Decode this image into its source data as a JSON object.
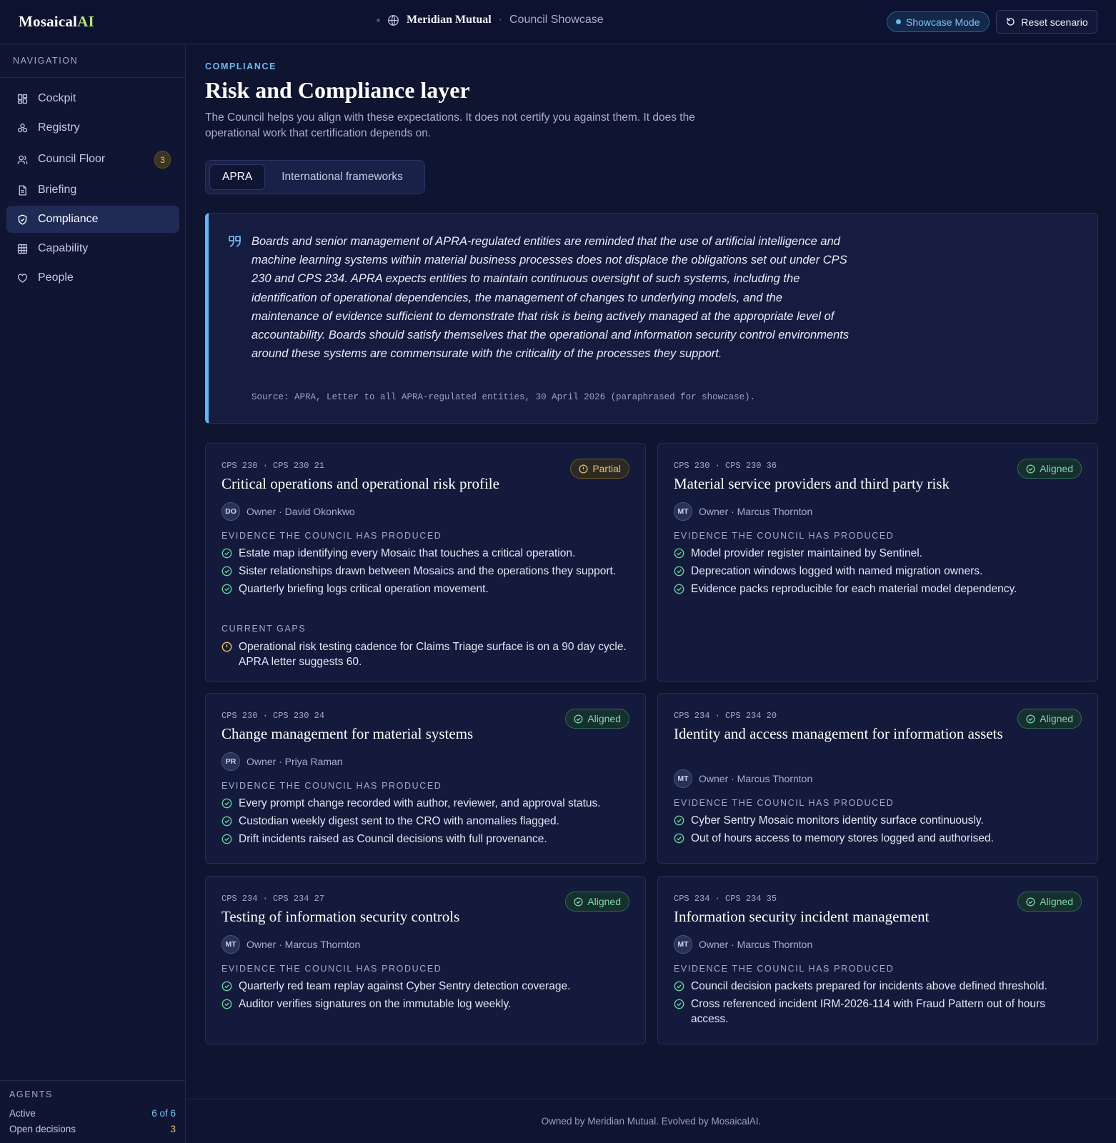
{
  "brand": {
    "name_main": "Mosaical",
    "name_accent": "AI"
  },
  "header": {
    "client": "Meridian Mutual",
    "separator": "·",
    "crumb": "Council Showcase",
    "showcase_label": "Showcase Mode",
    "reset_label": "Reset scenario"
  },
  "sidebar": {
    "heading": "NAVIGATION",
    "items": [
      {
        "label": "Cockpit",
        "icon": "grid-icon"
      },
      {
        "label": "Registry",
        "icon": "registry-icon"
      },
      {
        "label": "Council Floor",
        "icon": "users-icon",
        "badge": "3"
      },
      {
        "label": "Briefing",
        "icon": "document-icon"
      },
      {
        "label": "Compliance",
        "icon": "shield-icon",
        "active": true
      },
      {
        "label": "Capability",
        "icon": "table-icon"
      },
      {
        "label": "People",
        "icon": "heart-icon"
      }
    ],
    "agents": {
      "heading": "AGENTS",
      "active_label": "Active",
      "active_value": "6 of 6",
      "open_label": "Open decisions",
      "open_value": "3"
    }
  },
  "page": {
    "eyebrow": "COMPLIANCE",
    "title": "Risk and Compliance layer",
    "subtitle": "The Council helps you align with these expectations. It does not certify you against them. It does the operational work that certification depends on.",
    "tabs": [
      {
        "label": "APRA",
        "active": true
      },
      {
        "label": "International frameworks",
        "active": false
      }
    ]
  },
  "quote": {
    "text": "Boards and senior management of APRA-regulated entities are reminded that the use of artificial intelligence and machine learning systems within material business processes does not displace the obligations set out under CPS 230 and CPS 234. APRA expects entities to maintain continuous oversight of such systems, including the identification of operational dependencies, the management of changes to underlying models, and the maintenance of evidence sufficient to demonstrate that risk is being actively managed at the appropriate level of accountability. Boards should satisfy themselves that the operational and information security control environments around these systems are commensurate with the criticality of the processes they support.",
    "source": "Source: APRA, Letter to all APRA-regulated entities, 30 April 2026 (paraphrased for showcase)."
  },
  "labels": {
    "evidence": "EVIDENCE THE COUNCIL HAS PRODUCED",
    "gaps": "CURRENT GAPS"
  },
  "cards": [
    {
      "ref": "CPS 230 · CPS 230 21",
      "title": "Critical operations and operational risk profile",
      "status": "Partial",
      "owner_initials": "DO",
      "owner": "Owner · David Okonkwo",
      "evidence": [
        "Estate map identifying every Mosaic that touches a critical operation.",
        "Sister relationships drawn between Mosaics and the operations they support.",
        "Quarterly briefing logs critical operation movement."
      ],
      "gaps": [
        "Operational risk testing cadence for Claims Triage surface is on a 90 day cycle. APRA letter suggests 60."
      ]
    },
    {
      "ref": "CPS 230 · CPS 230 36",
      "title": "Material service providers and third party risk",
      "status": "Aligned",
      "owner_initials": "MT",
      "owner": "Owner · Marcus Thornton",
      "evidence": [
        "Model provider register maintained by Sentinel.",
        "Deprecation windows logged with named migration owners.",
        "Evidence packs reproducible for each material model dependency."
      ]
    },
    {
      "ref": "CPS 230 · CPS 230 24",
      "title": "Change management for material systems",
      "status": "Aligned",
      "owner_initials": "PR",
      "owner": "Owner · Priya Raman",
      "evidence": [
        "Every prompt change recorded with author, reviewer, and approval status.",
        "Custodian weekly digest sent to the CRO with anomalies flagged.",
        "Drift incidents raised as Council decisions with full provenance."
      ]
    },
    {
      "ref": "CPS 234 · CPS 234 20",
      "title": "Identity and access management for information assets",
      "status": "Aligned",
      "owner_initials": "MT",
      "owner": "Owner · Marcus Thornton",
      "evidence": [
        "Cyber Sentry Mosaic monitors identity surface continuously.",
        "Out of hours access to memory stores logged and authorised."
      ]
    },
    {
      "ref": "CPS 234 · CPS 234 27",
      "title": "Testing of information security controls",
      "status": "Aligned",
      "owner_initials": "MT",
      "owner": "Owner · Marcus Thornton",
      "evidence": [
        "Quarterly red team replay against Cyber Sentry detection coverage.",
        "Auditor verifies signatures on the immutable log weekly."
      ]
    },
    {
      "ref": "CPS 234 · CPS 234 35",
      "title": "Information security incident management",
      "status": "Aligned",
      "owner_initials": "MT",
      "owner": "Owner · Marcus Thornton",
      "evidence": [
        "Council decision packets prepared for incidents above defined threshold.",
        "Cross referenced incident IRM-2026-114 with Fraud Pattern out of hours access."
      ]
    }
  ],
  "footer": "Owned by Meridian Mutual. Evolved by MosaicalAI."
}
